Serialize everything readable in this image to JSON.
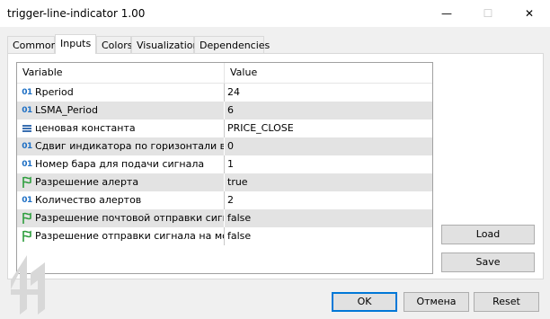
{
  "window": {
    "title": "trigger-line-indicator 1.00",
    "minimize_glyph": "—",
    "maximize_glyph": "☐",
    "close_glyph": "✕"
  },
  "tabs": [
    {
      "label": "Common"
    },
    {
      "label": "Inputs"
    },
    {
      "label": "Colors"
    },
    {
      "label": "Visualization"
    },
    {
      "label": "Dependencies"
    }
  ],
  "active_tab": "Inputs",
  "grid": {
    "header": {
      "variable": "Variable",
      "value": "Value"
    },
    "rows": [
      {
        "icon": "integer-icon",
        "name": "Rperiod",
        "value": "24"
      },
      {
        "icon": "integer-icon",
        "name": "LSMA_Period",
        "value": "6"
      },
      {
        "icon": "enum-icon",
        "name": "ценовая константа",
        "value": "PRICE_CLOSE"
      },
      {
        "icon": "integer-icon",
        "name": "Сдвиг индикатора по горизонтали в ...",
        "value": "0"
      },
      {
        "icon": "integer-icon",
        "name": "Номер бара для подачи сигнала",
        "value": "1"
      },
      {
        "icon": "bool-icon",
        "name": "Разрешение алерта",
        "value": "true"
      },
      {
        "icon": "integer-icon",
        "name": "Количество алертов",
        "value": "2"
      },
      {
        "icon": "bool-icon",
        "name": "Разрешение почтовой отправки сигн...",
        "value": "false"
      },
      {
        "icon": "bool-icon",
        "name": "Разрешение отправки сигнала на моб...",
        "value": "false"
      }
    ]
  },
  "side_buttons": {
    "load": "Load",
    "save": "Save"
  },
  "footer_buttons": {
    "ok": "OK",
    "cancel": "Отмена",
    "reset": "Reset"
  },
  "integer_icon_text": "01",
  "colors": {
    "accent": "#0078d7",
    "integer_icon": "#1d6fc4",
    "bool_icon": "#2e9e3e",
    "enum_icon": "#3a6fb0"
  }
}
